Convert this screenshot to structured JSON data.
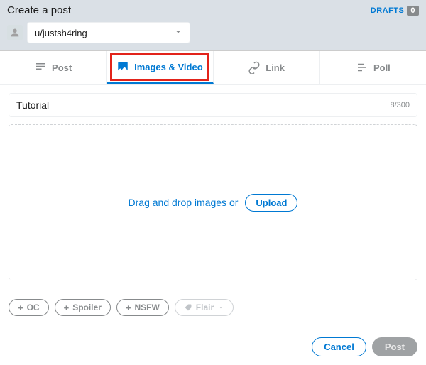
{
  "header": {
    "title": "Create a post",
    "drafts_label": "DRAFTS",
    "drafts_count": "0"
  },
  "community": {
    "name": "u/justsh4ring"
  },
  "tabs": {
    "post": "Post",
    "images": "Images & Video",
    "link": "Link",
    "poll": "Poll"
  },
  "title_field": {
    "value": "Tutorial",
    "count": "8/300"
  },
  "dropzone": {
    "text": "Drag and drop images or",
    "upload": "Upload"
  },
  "tags": {
    "oc": "OC",
    "spoiler": "Spoiler",
    "nsfw": "NSFW",
    "flair": "Flair"
  },
  "footer": {
    "cancel": "Cancel",
    "post": "Post"
  }
}
